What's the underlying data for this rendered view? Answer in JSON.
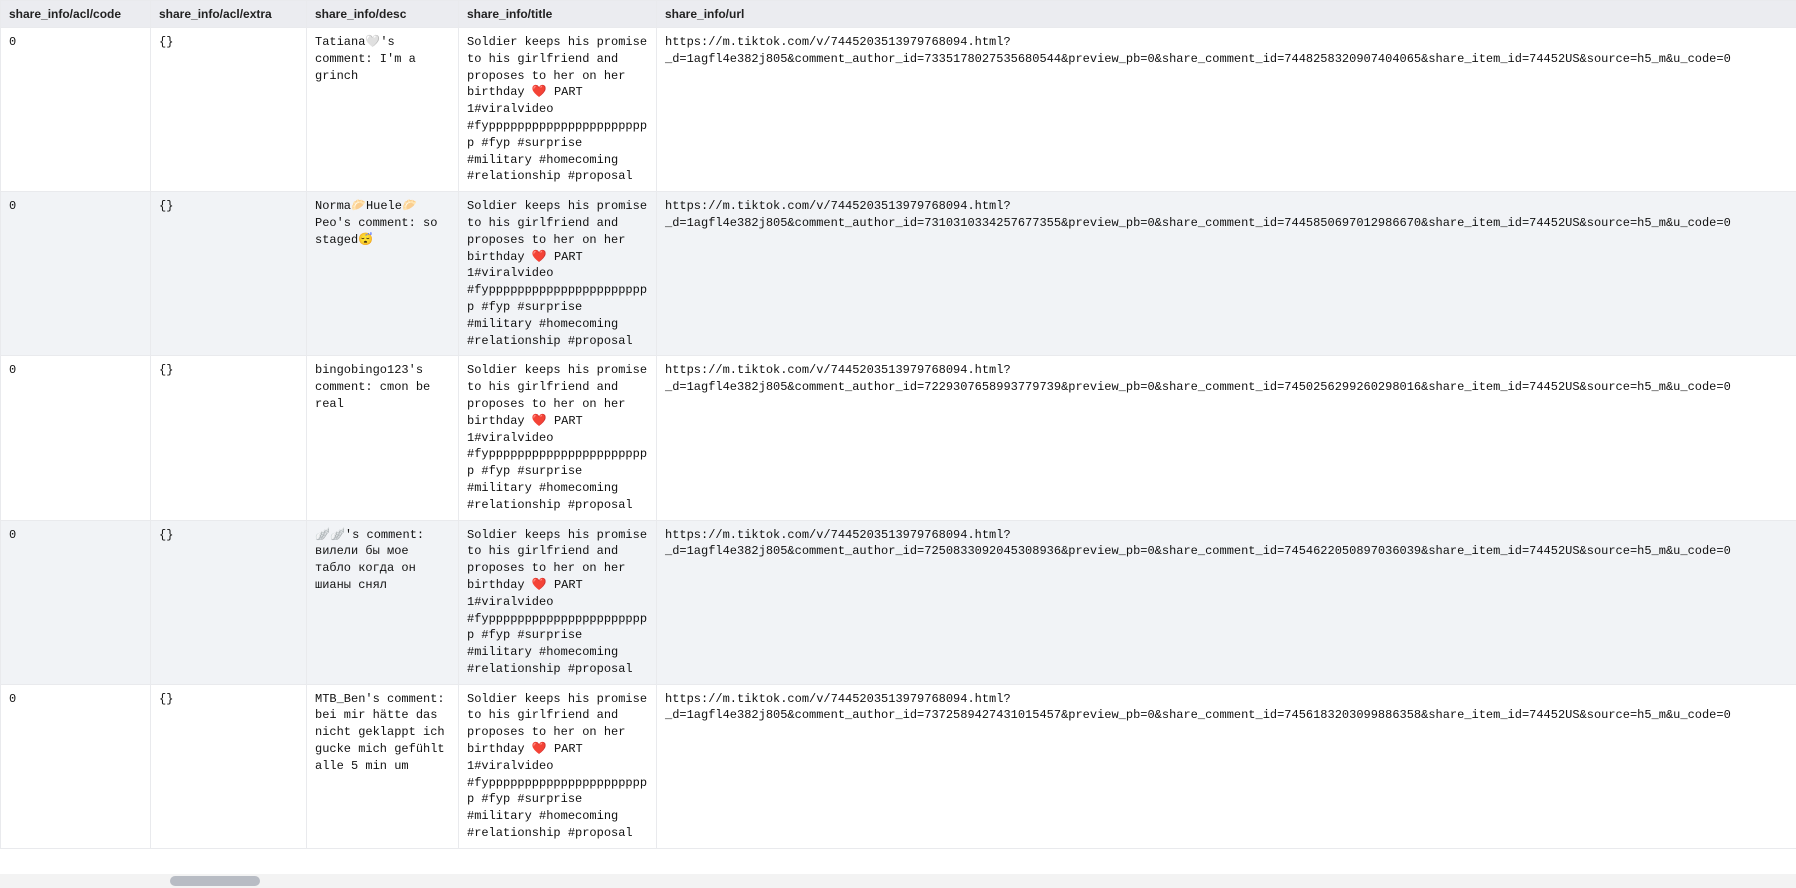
{
  "columns": [
    "share_info/acl/code",
    "share_info/acl/extra",
    "share_info/desc",
    "share_info/title",
    "share_info/url"
  ],
  "shared_title": "Soldier keeps his promise to his girlfriend and proposes to her on her birthday ❤️ PART 1#viralvideo #fyppppppppppppppppppppppp #fyp #surprise #military #homecoming #relationship #proposal",
  "rows": [
    {
      "code": "0",
      "extra": "{}",
      "desc": "Tatiana🤍's comment: I'm a grinch",
      "url": "https://m.tiktok.com/v/7445203513979768094.html?_d=1agfl4e382j805&comment_author_id=7335178027535680544&preview_pb=0&share_comment_id=7448258320907404065&share_item_id=74452US&source=h5_m&u_code=0"
    },
    {
      "code": "0",
      "extra": "{}",
      "desc": "Norma🥟Huele🥟Peo's comment: so staged😴",
      "url": "https://m.tiktok.com/v/7445203513979768094.html?_d=1agfl4e382j805&comment_author_id=7310310334257677355&preview_pb=0&share_comment_id=7445850697012986670&share_item_id=74452US&source=h5_m&u_code=0"
    },
    {
      "code": "0",
      "extra": "{}",
      "desc": "bingobingo123's comment: cmon be real",
      "url": "https://m.tiktok.com/v/7445203513979768094.html?_d=1agfl4e382j805&comment_author_id=7229307658993779739&preview_pb=0&share_comment_id=7450256299260298016&share_item_id=74452US&source=h5_m&u_code=0"
    },
    {
      "code": "0",
      "extra": "{}",
      "desc": "🪽🪽's comment: вилели бы мое табло когда он шианы снял",
      "url": "https://m.tiktok.com/v/7445203513979768094.html?_d=1agfl4e382j805&comment_author_id=7250833092045308936&preview_pb=0&share_comment_id=7454622050897036039&share_item_id=74452US&source=h5_m&u_code=0"
    },
    {
      "code": "0",
      "extra": "{}",
      "desc": "MTB_Ben's comment: bei mir hätte das nicht geklappt ich gucke mich gefühlt alle 5 min um",
      "url": "https://m.tiktok.com/v/7445203513979768094.html?_d=1agfl4e382j805&comment_author_id=7372589427431015457&preview_pb=0&share_comment_id=7456183203099886358&share_item_id=74452US&source=h5_m&u_code=0"
    }
  ]
}
